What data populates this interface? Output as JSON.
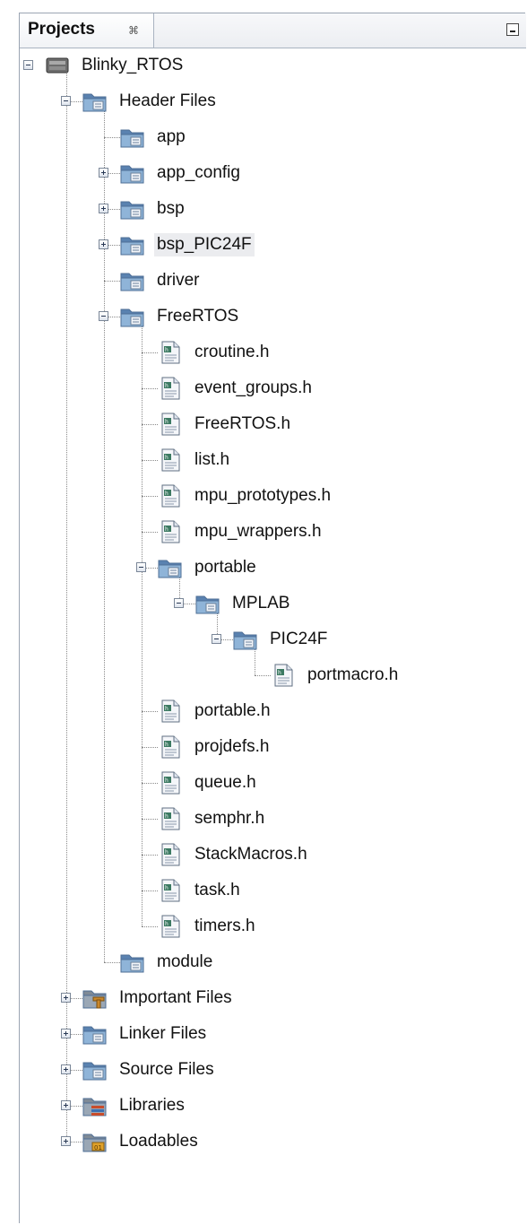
{
  "panel": {
    "title": "Projects",
    "close_glyph": "⌘",
    "minimize_icon": "minimize-icon"
  },
  "tree": [
    {
      "label": "Blinky_RTOS",
      "depth": 0,
      "icon": "project-chip-icon",
      "toggle": "expanded",
      "guide_to": 1001
    },
    {
      "label": "Header Files",
      "depth": 1,
      "icon": "logical-folder-icon",
      "toggle": "expanded",
      "guide_to": 1001
    },
    {
      "label": "app",
      "depth": 2,
      "icon": "logical-folder-icon",
      "toggle": "none"
    },
    {
      "label": "app_config",
      "depth": 2,
      "icon": "logical-folder-icon",
      "toggle": "collapsed"
    },
    {
      "label": "bsp",
      "depth": 2,
      "icon": "logical-folder-icon",
      "toggle": "collapsed"
    },
    {
      "label": "bsp_PIC24F",
      "depth": 2,
      "icon": "logical-folder-icon",
      "toggle": "collapsed",
      "selected": true
    },
    {
      "label": "driver",
      "depth": 2,
      "icon": "logical-folder-icon",
      "toggle": "none"
    },
    {
      "label": "FreeRTOS",
      "depth": 2,
      "icon": "logical-folder-icon",
      "toggle": "expanded"
    },
    {
      "label": "croutine.h",
      "depth": 3,
      "icon": "header-file-icon",
      "toggle": "none"
    },
    {
      "label": "event_groups.h",
      "depth": 3,
      "icon": "header-file-icon",
      "toggle": "none"
    },
    {
      "label": "FreeRTOS.h",
      "depth": 3,
      "icon": "header-file-icon",
      "toggle": "none"
    },
    {
      "label": "list.h",
      "depth": 3,
      "icon": "header-file-icon",
      "toggle": "none"
    },
    {
      "label": "mpu_prototypes.h",
      "depth": 3,
      "icon": "header-file-icon",
      "toggle": "none"
    },
    {
      "label": "mpu_wrappers.h",
      "depth": 3,
      "icon": "header-file-icon",
      "toggle": "none"
    },
    {
      "label": "portable",
      "depth": 3,
      "icon": "logical-folder-icon",
      "toggle": "expanded"
    },
    {
      "label": "MPLAB",
      "depth": 4,
      "icon": "logical-folder-icon",
      "toggle": "expanded"
    },
    {
      "label": "PIC24F",
      "depth": 5,
      "icon": "logical-folder-icon",
      "toggle": "expanded"
    },
    {
      "label": "portmacro.h",
      "depth": 6,
      "icon": "header-file-icon",
      "toggle": "none"
    },
    {
      "label": "portable.h",
      "depth": 3,
      "icon": "header-file-icon",
      "toggle": "none"
    },
    {
      "label": "projdefs.h",
      "depth": 3,
      "icon": "header-file-icon",
      "toggle": "none"
    },
    {
      "label": "queue.h",
      "depth": 3,
      "icon": "header-file-icon",
      "toggle": "none"
    },
    {
      "label": "semphr.h",
      "depth": 3,
      "icon": "header-file-icon",
      "toggle": "none"
    },
    {
      "label": "StackMacros.h",
      "depth": 3,
      "icon": "header-file-icon",
      "toggle": "none"
    },
    {
      "label": "task.h",
      "depth": 3,
      "icon": "header-file-icon",
      "toggle": "none"
    },
    {
      "label": "timers.h",
      "depth": 3,
      "icon": "header-file-icon",
      "toggle": "none"
    },
    {
      "label": "module",
      "depth": 2,
      "icon": "logical-folder-icon",
      "toggle": "none"
    },
    {
      "label": "Important Files",
      "depth": 1,
      "icon": "important-folder-icon",
      "toggle": "collapsed"
    },
    {
      "label": "Linker Files",
      "depth": 1,
      "icon": "logical-folder-icon",
      "toggle": "collapsed"
    },
    {
      "label": "Source Files",
      "depth": 1,
      "icon": "logical-folder-icon",
      "toggle": "collapsed"
    },
    {
      "label": "Libraries",
      "depth": 1,
      "icon": "library-folder-icon",
      "toggle": "collapsed"
    },
    {
      "label": "Loadables",
      "depth": 1,
      "icon": "loadables-folder-icon",
      "toggle": "collapsed"
    }
  ],
  "colors": {
    "folder": "#8fb4d8",
    "folder_dark": "#5a82b0",
    "selection": "#ebecef",
    "guide": "#8a8a8a"
  }
}
